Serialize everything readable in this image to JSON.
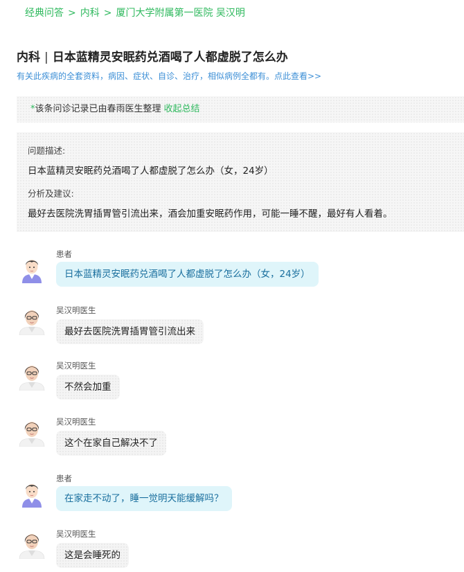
{
  "breadcrumb": {
    "items": [
      "经典问答",
      "内科",
      "厦门大学附属第一医院 吴汉明"
    ],
    "separator": ">"
  },
  "title": {
    "department": "内科",
    "divider": "|",
    "question": "日本蓝精灵安眠药兑酒喝了人都虚脱了怎么办"
  },
  "subtitle": "有关此疾病的全套资料，病因、症状、自诊、治疗，相似病例全都有。点此查看>>",
  "notice": {
    "star": "*",
    "text": "该条问诊记录已由春雨医生整理",
    "link": "收起总结"
  },
  "summary": {
    "problem_label": "问题描述:",
    "problem_text": "日本蓝精灵安眠药兑酒喝了人都虚脱了怎么办（女，24岁）",
    "advice_label": "分析及建议:",
    "advice_text": "最好去医院洗胃插胃管引流出来，酒会加重安眠药作用，可能一睡不醒，最好有人看着。"
  },
  "messages": [
    {
      "role": "patient",
      "name": "患者",
      "text": "日本蓝精灵安眠药兑酒喝了人都虚脱了怎么办（女，24岁）"
    },
    {
      "role": "doctor",
      "name": "吴汉明医生",
      "text": "最好去医院洗胃插胃管引流出来"
    },
    {
      "role": "doctor",
      "name": "吴汉明医生",
      "text": "不然会加重"
    },
    {
      "role": "doctor",
      "name": "吴汉明医生",
      "text": "这个在家自己解决不了"
    },
    {
      "role": "patient",
      "name": "患者",
      "text": "在家走不动了，睡一觉明天能缓解吗？"
    },
    {
      "role": "doctor",
      "name": "吴汉明医生",
      "text": "这是会睡死的"
    }
  ],
  "colors": {
    "accent_green": "#2fb95e",
    "link_blue": "#3d8fd6",
    "patient_bubble": "#dff5fa",
    "doctor_bubble": "#f4f4f4"
  }
}
